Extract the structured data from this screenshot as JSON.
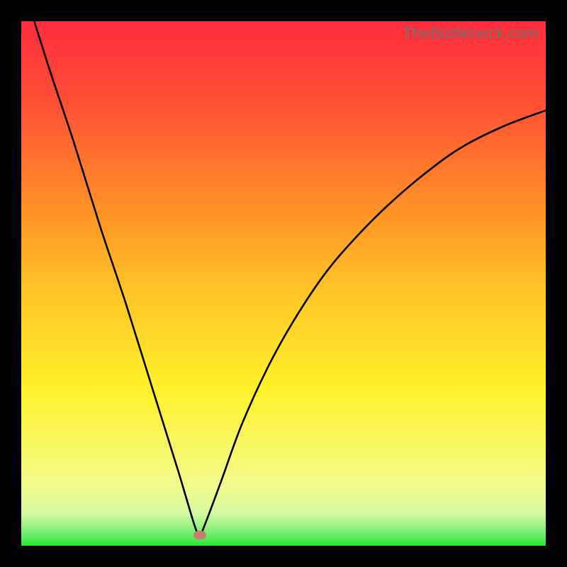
{
  "watermark": "TheBottleneck.com",
  "colors": {
    "frame": "#000000",
    "curve": "#000000",
    "marker": "#cb7b71",
    "gradient_top": "#ff2e3c",
    "gradient_bottom": "#2ae62a"
  },
  "chart_data": {
    "type": "line",
    "title": "",
    "xlabel": "",
    "ylabel": "",
    "xlim": [
      0,
      100
    ],
    "ylim": [
      0,
      100
    ],
    "grid": false,
    "legend": false,
    "marker": {
      "x": 34,
      "y": 2
    },
    "series": [
      {
        "name": "bottleneck-curve",
        "x": [
          0,
          5,
          10,
          15,
          20,
          25,
          30,
          33,
          34,
          35,
          38,
          42,
          47,
          52,
          58,
          64,
          70,
          77,
          84,
          92,
          100
        ],
        "y": [
          108,
          92,
          77,
          61,
          46,
          30,
          14,
          4,
          2,
          4,
          12,
          23,
          34,
          43,
          52,
          59,
          65,
          71,
          76,
          80,
          83
        ]
      }
    ]
  }
}
